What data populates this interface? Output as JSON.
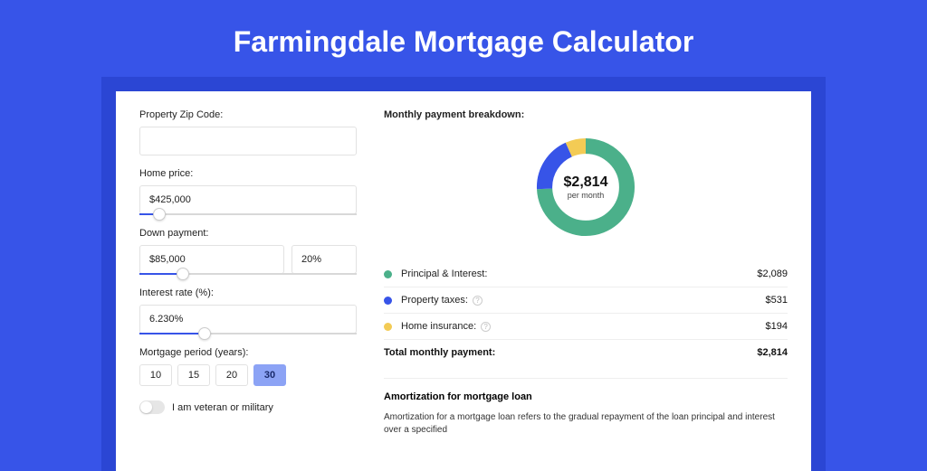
{
  "title": "Farmingdale Mortgage Calculator",
  "form": {
    "zip_label": "Property Zip Code:",
    "zip_value": "",
    "home_price_label": "Home price:",
    "home_price_value": "$425,000",
    "down_payment_label": "Down payment:",
    "down_payment_value": "$85,000",
    "down_payment_pct": "20%",
    "interest_label": "Interest rate (%):",
    "interest_value": "6.230%",
    "period_label": "Mortgage period (years):",
    "periods": [
      "10",
      "15",
      "20",
      "30"
    ],
    "period_selected": "30",
    "veteran_label": "I am veteran or military"
  },
  "breakdown": {
    "title": "Monthly payment breakdown:",
    "center_amount": "$2,814",
    "center_sub": "per month",
    "items": [
      {
        "label": "Principal & Interest:",
        "value": "$2,089",
        "color": "#4bb08a",
        "info": false
      },
      {
        "label": "Property taxes:",
        "value": "$531",
        "color": "#3754e8",
        "info": true
      },
      {
        "label": "Home insurance:",
        "value": "$194",
        "color": "#f3cb55",
        "info": true
      }
    ],
    "total_label": "Total monthly payment:",
    "total_value": "$2,814"
  },
  "amortization": {
    "title": "Amortization for mortgage loan",
    "text": "Amortization for a mortgage loan refers to the gradual repayment of the loan principal and interest over a specified"
  },
  "chart_data": {
    "type": "pie",
    "title": "Monthly payment breakdown",
    "series": [
      {
        "name": "Principal & Interest",
        "value": 2089,
        "color": "#4bb08a"
      },
      {
        "name": "Property taxes",
        "value": 531,
        "color": "#3754e8"
      },
      {
        "name": "Home insurance",
        "value": 194,
        "color": "#f3cb55"
      }
    ],
    "total": 2814,
    "center_label": "$2,814 per month"
  }
}
